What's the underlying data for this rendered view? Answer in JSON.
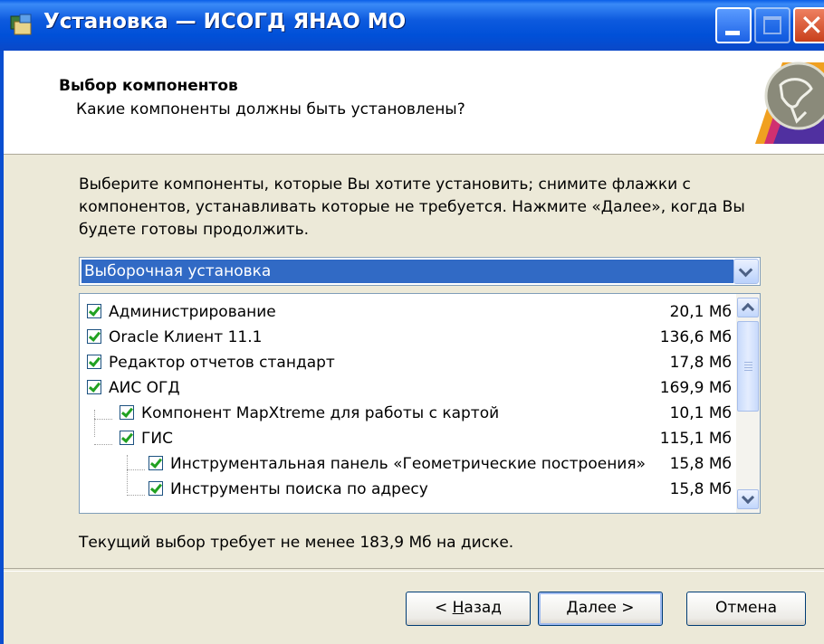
{
  "window": {
    "title": "Установка — ИСОГД ЯНАО МО",
    "icon": "installer-icon",
    "controls": [
      "minimize-icon",
      "maximize-icon",
      "close-icon"
    ],
    "close_glyph": "✕"
  },
  "header": {
    "title": "Выбор компонентов",
    "subtitle": "Какие компоненты должны быть установлены?"
  },
  "description": "Выберите компоненты, которые Вы хотите установить; снимите флажки с компонентов, устанавливать которые не требуется. Нажмите «Далее», когда Вы будете готовы продолжить.",
  "setup_type": {
    "selected": "Выборочная установка"
  },
  "components": [
    {
      "label": "Администрирование",
      "size": "20,1 Мб",
      "level": 0,
      "checked": true
    },
    {
      "label": "Oracle Клиент 11.1",
      "size": "136,6 Мб",
      "level": 0,
      "checked": true
    },
    {
      "label": "Редактор отчетов стандарт",
      "size": "17,8 Мб",
      "level": 0,
      "checked": true
    },
    {
      "label": "АИС ОГД",
      "size": "169,9 Мб",
      "level": 0,
      "checked": true
    },
    {
      "label": "Компонент MapXtreme для работы с картой",
      "size": "10,1 Мб",
      "level": 1,
      "checked": true
    },
    {
      "label": "ГИС",
      "size": "115,1 Мб",
      "level": 1,
      "checked": true
    },
    {
      "label": "Инструментальная панель «Геометрические построения»",
      "size": "15,8 Мб",
      "level": 2,
      "checked": true
    },
    {
      "label": "Инструменты поиска по адресу",
      "size": "15,8 Мб",
      "level": 2,
      "checked": true
    }
  ],
  "disk_requirement": "Текущий выбор требует не менее 183,9 Мб на диске.",
  "buttons": {
    "back_prefix": "< ",
    "back_mnemonic": "Н",
    "back_rest": "азад",
    "next_mnemonic": "Д",
    "next_rest": "алее >",
    "cancel": "Отмена"
  },
  "colors": {
    "titlebar": "#0a5ee8",
    "selection": "#316ac5",
    "check": "#21a121",
    "window_bg": "#ece9d8"
  }
}
